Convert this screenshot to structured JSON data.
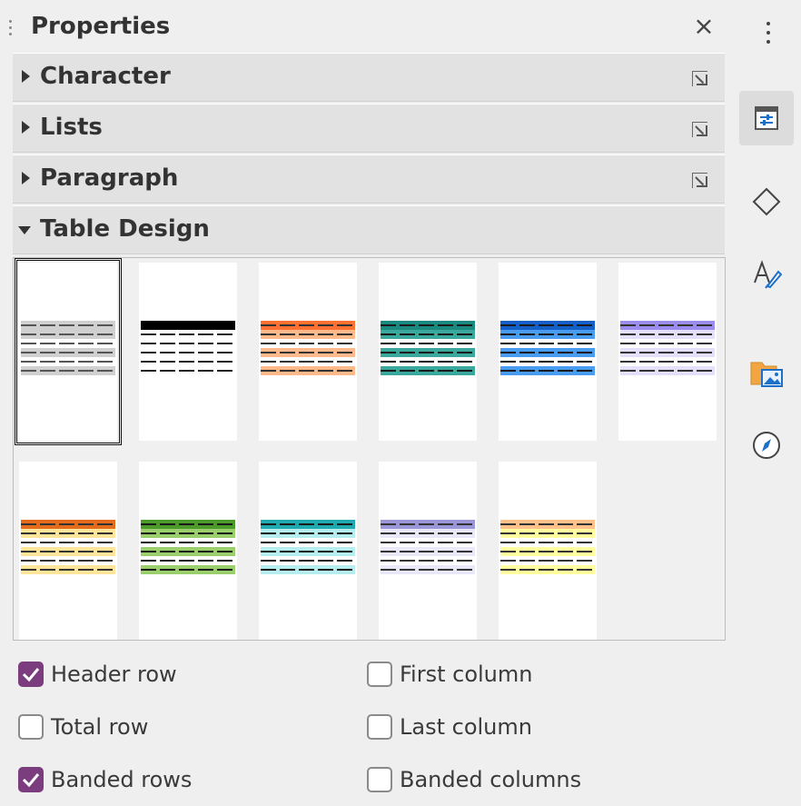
{
  "panel": {
    "title": "Properties",
    "close_glyph": "×"
  },
  "sections": [
    {
      "label": "Character",
      "expanded": false
    },
    {
      "label": "Lists",
      "expanded": false
    },
    {
      "label": "Paragraph",
      "expanded": false
    },
    {
      "label": "Table Design",
      "expanded": true
    }
  ],
  "table_styles": [
    {
      "index": 1,
      "selected": true,
      "header": "#d0d0d0",
      "band": "#d0d0d0",
      "line": "#555555"
    },
    {
      "index": 2,
      "selected": false,
      "header": "#000000",
      "band": "#ffffff",
      "line": "#222222"
    },
    {
      "index": 3,
      "selected": false,
      "header": "#ff7033",
      "band": "#ffb98a",
      "line": "#333333"
    },
    {
      "index": 4,
      "selected": false,
      "header": "#1a8a80",
      "band": "#3aa89c",
      "line": "#1a1a1a"
    },
    {
      "index": 5,
      "selected": false,
      "header": "#1560c8",
      "band": "#4a9cf0",
      "line": "#1a1a1a"
    },
    {
      "index": 6,
      "selected": false,
      "header": "#9b8cf0",
      "band": "#e4e0fb",
      "line": "#333333"
    },
    {
      "index": 7,
      "selected": false,
      "header": "#e46a1c",
      "band": "#ffe59a",
      "line": "#333333"
    },
    {
      "index": 8,
      "selected": false,
      "header": "#4c9a2a",
      "band": "#9bcf6e",
      "line": "#1a1a1a"
    },
    {
      "index": 9,
      "selected": false,
      "header": "#20aab0",
      "band": "#b6eef0",
      "line": "#1a1a1a"
    },
    {
      "index": 10,
      "selected": false,
      "header": "#9a96d8",
      "band": "#e8e8f8",
      "line": "#333333"
    },
    {
      "index": 11,
      "selected": false,
      "header": "#ffc08a",
      "band": "#ffffa0",
      "line": "#333333"
    }
  ],
  "options": [
    {
      "label": "Header row",
      "checked": true
    },
    {
      "label": "First column",
      "checked": false
    },
    {
      "label": "Total row",
      "checked": false
    },
    {
      "label": "Last column",
      "checked": false
    },
    {
      "label": "Banded rows",
      "checked": true
    },
    {
      "label": "Banded columns",
      "checked": false
    }
  ],
  "tabbar": {
    "items": [
      {
        "icon": "properties-icon",
        "active": true
      },
      {
        "icon": "shapes-icon",
        "active": false
      },
      {
        "icon": "styles-icon",
        "active": false
      },
      {
        "icon": "gallery-icon",
        "active": false
      },
      {
        "icon": "navigator-icon",
        "active": false
      }
    ]
  },
  "colors": {
    "checkbox_accent": "#7b3d7e",
    "section_bg": "#e2e2e2",
    "panel_bg": "#efefef"
  }
}
